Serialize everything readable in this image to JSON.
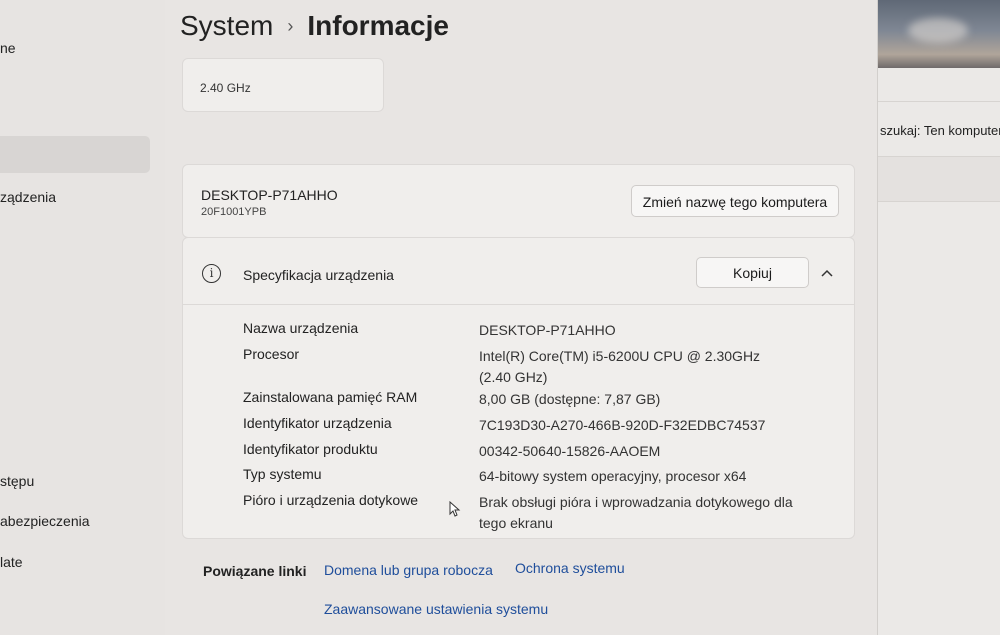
{
  "sidebar": {
    "items": [
      {
        "label": "ne"
      },
      {
        "label": "ządzenia"
      },
      {
        "label": "stępu"
      },
      {
        "label": "abezpieczenia"
      },
      {
        "label": "late"
      }
    ]
  },
  "breadcrumb": {
    "parent": "System",
    "separator": "›",
    "current": "Informacje"
  },
  "processor_speed": "2.40 GHz",
  "device": {
    "name": "DESKTOP-P71AHHO",
    "model": "20F1001YPB",
    "rename_label": "Zmień nazwę tego komputera"
  },
  "specs": {
    "title": "Specyfikacja urządzenia",
    "copy_label": "Kopiuj",
    "rows": [
      {
        "label": "Nazwa urządzenia",
        "value": "DESKTOP-P71AHHO"
      },
      {
        "label": "Procesor",
        "value": "Intel(R) Core(TM) i5-6200U CPU @ 2.30GHz (2.40 GHz)"
      },
      {
        "label": "Zainstalowana pamięć RAM",
        "value": "8,00 GB (dostępne: 7,87 GB)"
      },
      {
        "label": "Identyfikator urządzenia",
        "value": "7C193D30-A270-466B-920D-F32EDBC74537"
      },
      {
        "label": "Identyfikator produktu",
        "value": "00342-50640-15826-AAOEM"
      },
      {
        "label": "Typ systemu",
        "value": "64-bitowy system operacyjny, procesor x64"
      },
      {
        "label": "Pióro i urządzenia dotykowe",
        "value": "Brak obsługi pióra i wprowadzania dotykowego dla tego ekranu"
      }
    ]
  },
  "related": {
    "label": "Powiązane linki",
    "links": [
      {
        "label": "Domena lub grupa robocza"
      },
      {
        "label": "Ochrona systemu"
      },
      {
        "label": "Zaawansowane ustawienia systemu"
      }
    ]
  },
  "right_window": {
    "search_text": "szukaj: Ten komputer"
  },
  "colors": {
    "link": "#1f4e9b",
    "card": "#f0eeec",
    "background": "#e8e5e3"
  },
  "icons": [
    "info-icon",
    "chevron-up-icon",
    "mouse-cursor-icon"
  ]
}
